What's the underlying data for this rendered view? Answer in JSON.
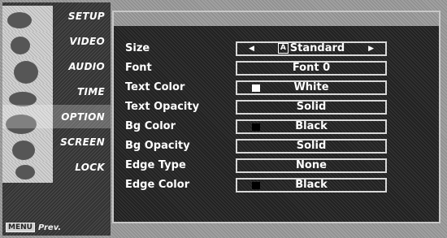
{
  "sidebar": {
    "items": [
      {
        "label": "SETUP"
      },
      {
        "label": "VIDEO"
      },
      {
        "label": "AUDIO"
      },
      {
        "label": "TIME"
      },
      {
        "label": "OPTION"
      },
      {
        "label": "SCREEN"
      },
      {
        "label": "LOCK"
      }
    ],
    "active_index": 4,
    "footer": {
      "key": "MENU",
      "label": "Prev."
    }
  },
  "settings": [
    {
      "name": "Size",
      "value": "Standard",
      "selector_glyph": "A",
      "has_arrows": true
    },
    {
      "name": "Font",
      "value": "Font  0"
    },
    {
      "name": "Text Color",
      "value": "White",
      "swatch": "#ffffff"
    },
    {
      "name": "Text Opacity",
      "value": "Solid"
    },
    {
      "name": "Bg Color",
      "value": "Black",
      "swatch": "#000000"
    },
    {
      "name": "Bg Opacity",
      "value": "Solid"
    },
    {
      "name": "Edge Type",
      "value": "None"
    },
    {
      "name": "Edge Color",
      "value": "Black",
      "swatch": "#000000"
    }
  ],
  "icons": {
    "left_arrow": "left-arrow-icon",
    "right_arrow": "right-arrow-icon"
  }
}
